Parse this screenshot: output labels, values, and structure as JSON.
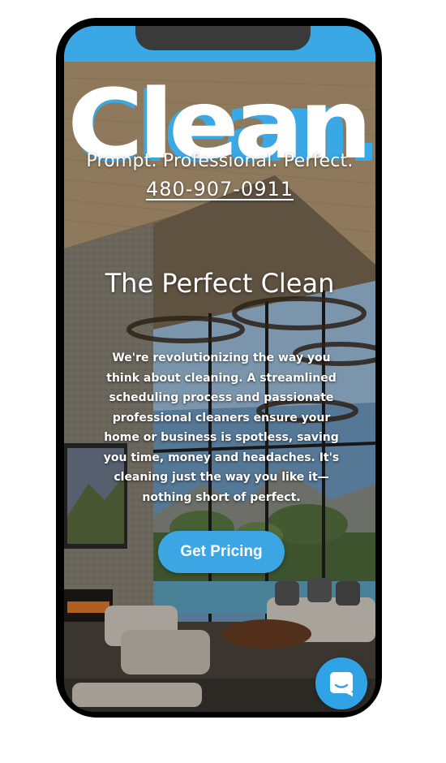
{
  "brand": {
    "logo_text": "Clean.",
    "tagline": "Prompt. Professional. Perfect.",
    "phone": "480-907-0911"
  },
  "hero": {
    "title": "The Perfect Clean",
    "body": "We're revolutionizing the way you think about cleaning. A streamlined scheduling process and passionate professional cleaners ensure your home or business is spotless, saving you time, money and headaches. It's cleaning just the way you like it—nothing short of perfect.",
    "cta_label": "Get Pricing"
  },
  "colors": {
    "accent": "#3aa8e4",
    "text": "#ffffff"
  },
  "icons": {
    "chat": "chat-bubble-icon"
  }
}
